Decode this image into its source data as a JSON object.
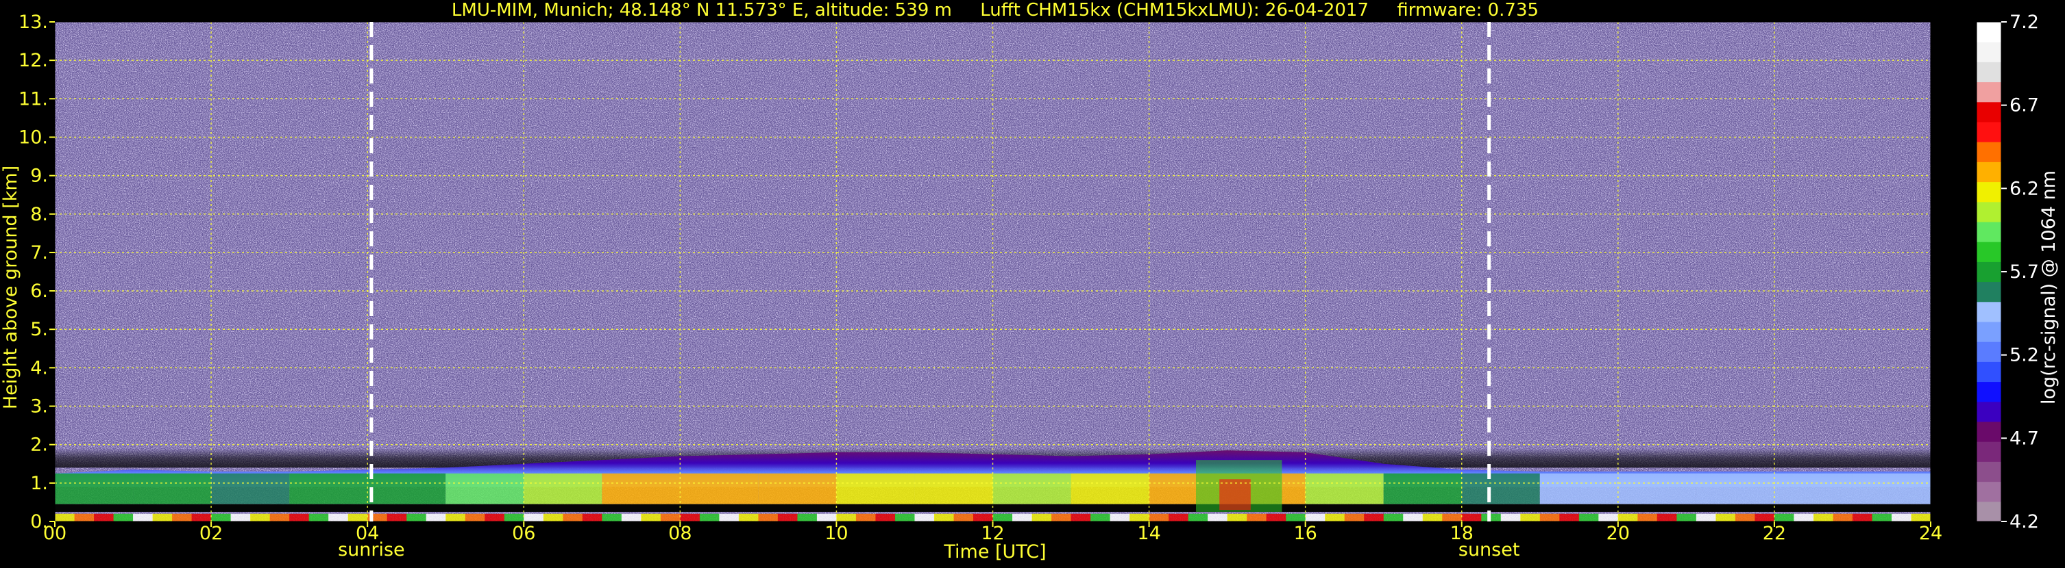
{
  "chart_data": {
    "type": "heatmap",
    "title": "LMU-MIM, Munich; 48.148° N 11.573° E, altitude: 539 m     Lufft CHM15kx (CHM15kxLMU): 26-04-2017     firmware: 0.735",
    "xlabel": "Time [UTC]",
    "ylabel": "Height above ground [km]",
    "x_ticks": [
      "00",
      "02",
      "04",
      "06",
      "08",
      "10",
      "12",
      "14",
      "16",
      "18",
      "20",
      "22",
      "24"
    ],
    "y_ticks": [
      "0.",
      "1.",
      "2.",
      "3.",
      "4.",
      "5.",
      "6.",
      "7.",
      "8.",
      "9.",
      "10.",
      "11.",
      "12.",
      "13."
    ],
    "xlim": [
      0,
      24
    ],
    "ylim": [
      0,
      13
    ],
    "grid": true,
    "events": [
      {
        "label": "sunrise",
        "time_utc": 4.05
      },
      {
        "label": "sunset",
        "time_utc": 18.35
      }
    ],
    "colorbar": {
      "label": "log(rc-signal) @ 1064 nm",
      "ticks": [
        "4.2",
        "4.7",
        "5.2",
        "5.7",
        "6.2",
        "6.7",
        "7.2"
      ],
      "range": [
        4.2,
        7.2
      ],
      "colors": [
        "#a890a8",
        "#a070a0",
        "#8c4e8c",
        "#7a287a",
        "#6a0a6a",
        "#3b00c0",
        "#1010ff",
        "#3050ff",
        "#5a7cff",
        "#7aa0ff",
        "#a0c0ff",
        "#208060",
        "#18a030",
        "#28c828",
        "#60e860",
        "#b0f030",
        "#f0f000",
        "#ffb000",
        "#ff7000",
        "#ff1010",
        "#e80000",
        "#f0a0a0",
        "#e0e0e0",
        "#f4f4f4",
        "#ffffff"
      ]
    },
    "profile": [
      {
        "t": 0,
        "bl_top": 1.25,
        "bl_base": 0.35,
        "aerosol": 5.8
      },
      {
        "t": 1,
        "bl_top": 1.35,
        "bl_base": 0.35,
        "aerosol": 5.7
      },
      {
        "t": 2,
        "bl_top": 1.3,
        "bl_base": 0.35,
        "aerosol": 5.6
      },
      {
        "t": 3,
        "bl_top": 1.3,
        "bl_base": 0.35,
        "aerosol": 5.6
      },
      {
        "t": 4,
        "bl_top": 1.35,
        "bl_base": 0.35,
        "aerosol": 5.7
      },
      {
        "t": 5,
        "bl_top": 1.4,
        "bl_base": 0.35,
        "aerosol": 5.8
      },
      {
        "t": 6,
        "bl_top": 1.5,
        "bl_base": 0.3,
        "aerosol": 6.0
      },
      {
        "t": 7,
        "bl_top": 1.6,
        "bl_base": 0.3,
        "aerosol": 6.2
      },
      {
        "t": 8,
        "bl_top": 1.7,
        "bl_base": 0.3,
        "aerosol": 6.3
      },
      {
        "t": 9,
        "bl_top": 1.75,
        "bl_base": 0.3,
        "aerosol": 6.3
      },
      {
        "t": 10,
        "bl_top": 1.8,
        "bl_base": 0.3,
        "aerosol": 6.2
      },
      {
        "t": 11,
        "bl_top": 1.8,
        "bl_base": 0.3,
        "aerosol": 6.2
      },
      {
        "t": 12,
        "bl_top": 1.75,
        "bl_base": 0.3,
        "aerosol": 6.1
      },
      {
        "t": 13,
        "bl_top": 1.7,
        "bl_base": 0.3,
        "aerosol": 6.1
      },
      {
        "t": 14,
        "bl_top": 1.75,
        "bl_base": 0.3,
        "aerosol": 6.2
      },
      {
        "t": 15,
        "bl_top": 1.85,
        "bl_base": 0.3,
        "aerosol": 6.5
      },
      {
        "t": 16,
        "bl_top": 1.8,
        "bl_base": 0.3,
        "aerosol": 6.2
      },
      {
        "t": 17,
        "bl_top": 1.5,
        "bl_base": 0.35,
        "aerosol": 5.8
      },
      {
        "t": 18,
        "bl_top": 1.35,
        "bl_base": 0.35,
        "aerosol": 5.6
      },
      {
        "t": 19,
        "bl_top": 1.3,
        "bl_base": 0.35,
        "aerosol": 5.5
      },
      {
        "t": 20,
        "bl_top": 1.3,
        "bl_base": 0.35,
        "aerosol": 5.5
      },
      {
        "t": 21,
        "bl_top": 1.3,
        "bl_base": 0.35,
        "aerosol": 5.5
      },
      {
        "t": 22,
        "bl_top": 1.3,
        "bl_base": 0.35,
        "aerosol": 5.5
      },
      {
        "t": 23,
        "bl_top": 1.3,
        "bl_base": 0.35,
        "aerosol": 5.5
      },
      {
        "t": 24,
        "bl_top": 1.3,
        "bl_base": 0.35,
        "aerosol": 5.5
      }
    ]
  }
}
